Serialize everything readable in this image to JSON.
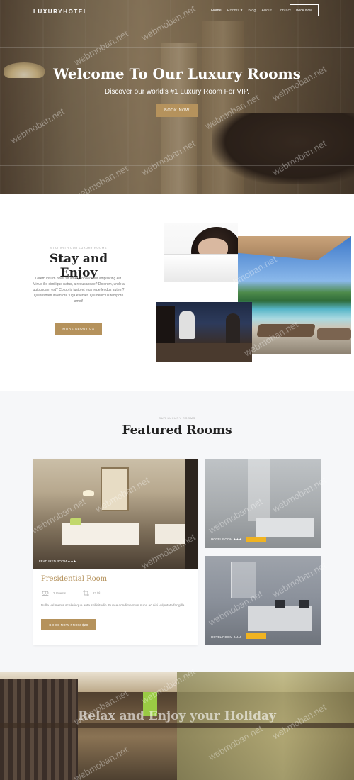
{
  "navbar": {
    "logo": "LUXURYHOTEL",
    "links": [
      {
        "label": "Home"
      },
      {
        "label": "Rooms ▾"
      },
      {
        "label": "Blog"
      },
      {
        "label": "About"
      },
      {
        "label": "Contact"
      }
    ],
    "book_now": "Book Now"
  },
  "hero": {
    "title": "Welcome To Our Luxury Rooms",
    "subtitle": "Discover our world's #1 Luxury Room For VIP.",
    "button": "BOOK NOW"
  },
  "about": {
    "eyebrow": "STAY WITH OUR LUXURY ROOMS",
    "title": "Stay and Enjoy",
    "text": "Lorem ipsum dolor sit amet, consectetur adipisicing elit. Minus illo similique natus, a recusandae? Dolorum, unde a quibusdam est? Corporis iusto et eius repellendus autem? Quibusdam inventore fuga eveniet! Qui delectus tempore amet!",
    "button": "MORE ABOUT US"
  },
  "rooms": {
    "eyebrow": "OUR LUXURY ROOMS",
    "title": "Featured Rooms",
    "featured": {
      "tag": "FEATURED ROOM ★★★",
      "name": "Presidential Room",
      "guests": "2 Guests",
      "size": "22 ft²",
      "description": "Nulla vel metus scelerisque ante sollicitudin. Fusce condimentum nunc ac nisi vulputate fringilla.",
      "button": "BOOK NOW FROM $20"
    },
    "side": [
      {
        "tag": "HOTEL ROOM ★★★",
        "badge_color": "#f0b321"
      },
      {
        "tag": "HOTEL ROOM ★★★",
        "badge_color": "#f0b321"
      }
    ]
  },
  "holiday": {
    "title": "Relax and Enjoy your Holiday"
  },
  "watermark": "webmoban.net",
  "colors": {
    "accent": "#b5925c",
    "badge": "#f0b321",
    "section_bg": "#f6f7f9"
  }
}
